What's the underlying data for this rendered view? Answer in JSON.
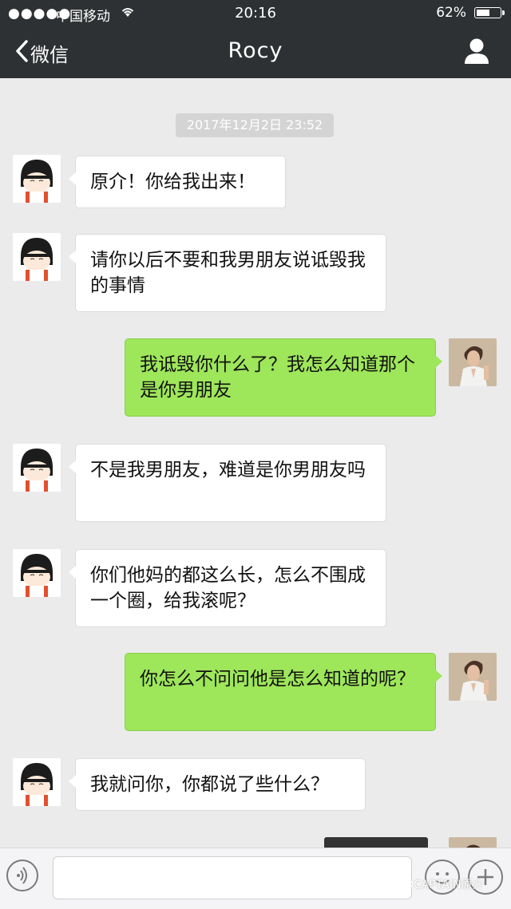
{
  "status_bar": {
    "signal": "●●●●●",
    "carrier": "中国移动",
    "time": "20:16",
    "battery_text": "62%",
    "battery_level": 0.62
  },
  "nav": {
    "back_label": "微信",
    "title": "Rocy"
  },
  "chat": {
    "timestamp": "2017年12月2日 23:52",
    "messages": [
      {
        "side": "left",
        "text": "原介！你给我出来！"
      },
      {
        "side": "left",
        "text": "请你以后不要和我男朋友说诋毁我的事情"
      },
      {
        "side": "right",
        "text": "我诋毁你什么了？我怎么知道那个是你男朋友"
      },
      {
        "side": "left",
        "text": "不是我男朋友，难道是你男朋友吗"
      },
      {
        "side": "left",
        "text": "你们他妈的都这么长，怎么不围成一个圈，给我滚呢？"
      },
      {
        "side": "right",
        "text": "你怎么不问问他是怎么知道的呢？"
      },
      {
        "side": "left",
        "text": "我就问你，你都说了些什么？"
      }
    ]
  },
  "watermark": "CAPTAIN原介",
  "colors": {
    "nav_bg": "#2e3133",
    "chat_bg": "#ebebeb",
    "bubble_left": "#ffffff",
    "bubble_right": "#9ee65a"
  },
  "icons": {
    "back": "chevron-left-icon",
    "profile": "person-icon",
    "voice": "voice-icon",
    "emoji": "emoji-icon",
    "plus": "plus-icon",
    "wifi": "wifi-icon",
    "battery": "battery-icon"
  }
}
